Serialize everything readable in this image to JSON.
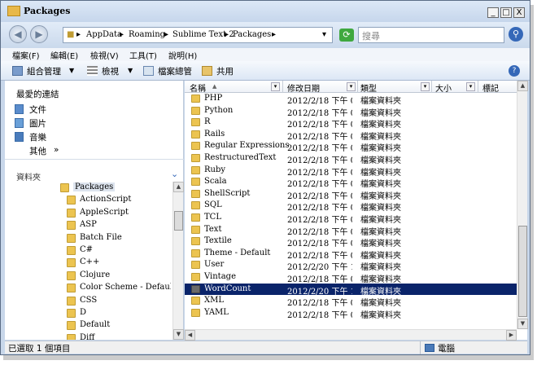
{
  "window": {
    "title": "Packages",
    "minimize": "_",
    "maximize": "□",
    "close": "X"
  },
  "address": {
    "crumbs": [
      "AppData",
      "Roaming",
      "Sublime Text 2",
      "Packages"
    ],
    "search_placeholder": "搜尋"
  },
  "menu": [
    "檔案(F)",
    "編輯(E)",
    "檢視(V)",
    "工具(T)",
    "說明(H)"
  ],
  "toolbar": {
    "organize": "組合管理",
    "views": "檢視",
    "burn": "檔案總管",
    "share": "共用"
  },
  "sidebar": {
    "favorites_title": "最愛的連結",
    "favorites": [
      "文件",
      "圖片",
      "音樂",
      "其他"
    ],
    "more": "»",
    "folders_title": "資料夾",
    "tree": [
      {
        "name": "Packages",
        "depth": 0
      },
      {
        "name": "ActionScript",
        "depth": 1
      },
      {
        "name": "AppleScript",
        "depth": 1
      },
      {
        "name": "ASP",
        "depth": 1
      },
      {
        "name": "Batch File",
        "depth": 1
      },
      {
        "name": "C#",
        "depth": 1
      },
      {
        "name": "C++",
        "depth": 1
      },
      {
        "name": "Clojure",
        "depth": 1
      },
      {
        "name": "Color Scheme - Default",
        "depth": 1
      },
      {
        "name": "CSS",
        "depth": 1
      },
      {
        "name": "D",
        "depth": 1
      },
      {
        "name": "Default",
        "depth": 1
      },
      {
        "name": "Diff",
        "depth": 1
      }
    ]
  },
  "columns": {
    "name": "名稱",
    "modified": "修改日期",
    "type": "類型",
    "size": "大小",
    "tags": "標記"
  },
  "files": [
    {
      "name": "PHP",
      "date": "2012/2/18 下午 0…",
      "type": "檔案資料夾",
      "selected": false
    },
    {
      "name": "Python",
      "date": "2012/2/18 下午 0…",
      "type": "檔案資料夾",
      "selected": false
    },
    {
      "name": "R",
      "date": "2012/2/18 下午 0…",
      "type": "檔案資料夾",
      "selected": false
    },
    {
      "name": "Rails",
      "date": "2012/2/18 下午 0…",
      "type": "檔案資料夾",
      "selected": false
    },
    {
      "name": "Regular Expressions",
      "date": "2012/2/18 下午 0…",
      "type": "檔案資料夾",
      "selected": false
    },
    {
      "name": "RestructuredText",
      "date": "2012/2/18 下午 0…",
      "type": "檔案資料夾",
      "selected": false
    },
    {
      "name": "Ruby",
      "date": "2012/2/18 下午 0…",
      "type": "檔案資料夾",
      "selected": false
    },
    {
      "name": "Scala",
      "date": "2012/2/18 下午 0…",
      "type": "檔案資料夾",
      "selected": false
    },
    {
      "name": "ShellScript",
      "date": "2012/2/18 下午 0…",
      "type": "檔案資料夾",
      "selected": false
    },
    {
      "name": "SQL",
      "date": "2012/2/18 下午 0…",
      "type": "檔案資料夾",
      "selected": false
    },
    {
      "name": "TCL",
      "date": "2012/2/18 下午 0…",
      "type": "檔案資料夾",
      "selected": false
    },
    {
      "name": "Text",
      "date": "2012/2/18 下午 0…",
      "type": "檔案資料夾",
      "selected": false
    },
    {
      "name": "Textile",
      "date": "2012/2/18 下午 0…",
      "type": "檔案資料夾",
      "selected": false
    },
    {
      "name": "Theme - Default",
      "date": "2012/2/18 下午 0…",
      "type": "檔案資料夾",
      "selected": false
    },
    {
      "name": "User",
      "date": "2012/2/20 下午 1…",
      "type": "檔案資料夾",
      "selected": false
    },
    {
      "name": "Vintage",
      "date": "2012/2/18 下午 0…",
      "type": "檔案資料夾",
      "selected": false
    },
    {
      "name": "WordCount",
      "date": "2012/2/20 下午 1…",
      "type": "檔案資料夾",
      "selected": true
    },
    {
      "name": "XML",
      "date": "2012/2/18 下午 0…",
      "type": "檔案資料夾",
      "selected": false
    },
    {
      "name": "YAML",
      "date": "2012/2/18 下午 0…",
      "type": "檔案資料夾",
      "selected": false
    }
  ],
  "status": {
    "selected": "已選取 1 個項目",
    "location": "電腦"
  },
  "colors": {
    "selection": "#0a246a",
    "folder": "#ecc450",
    "chrome": "#c8d7ea"
  }
}
